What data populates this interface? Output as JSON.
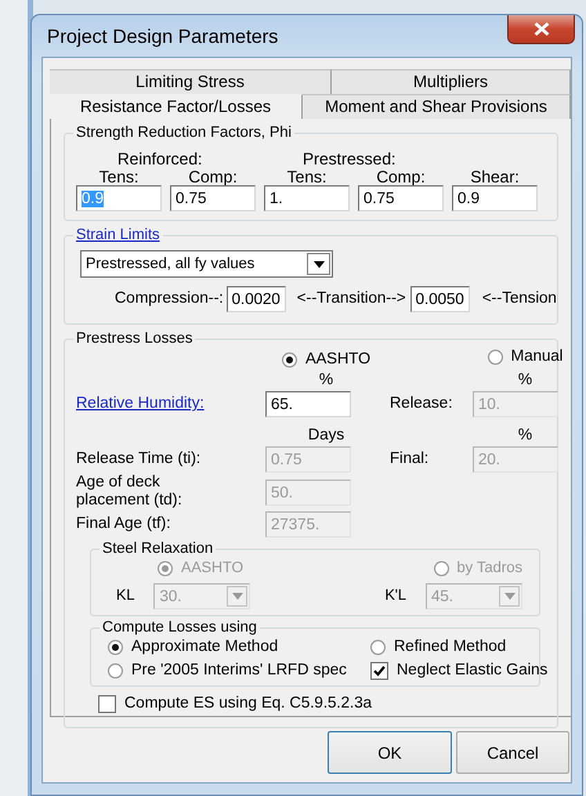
{
  "window": {
    "title": "Project Design Parameters"
  },
  "tab_rows": [
    [
      {
        "label": "Limiting Stress",
        "selected": false
      },
      {
        "label": "Multipliers",
        "selected": false
      }
    ],
    [
      {
        "label": "Resistance Factor/Losses",
        "selected": true
      },
      {
        "label": "Moment and Shear Provisions",
        "selected": false
      }
    ]
  ],
  "strength_reduction": {
    "title": "Strength Reduction Factors, Phi",
    "group_labels": [
      "Reinforced:",
      "Prestressed:"
    ],
    "fields": [
      {
        "label": "Tens:",
        "value": "0.9",
        "selected": true
      },
      {
        "label": "Comp:",
        "value": "0.75",
        "selected": false
      },
      {
        "label": "Tens:",
        "value": "1.",
        "selected": false
      },
      {
        "label": "Comp:",
        "value": "0.75",
        "selected": false
      },
      {
        "label": "Shear:",
        "value": "0.9",
        "selected": false
      }
    ]
  },
  "strain_limits": {
    "title": "Strain Limits",
    "dropdown": "Prestressed, all fy values",
    "compression_label": "Compression--:",
    "compression": "0.0020",
    "transition_label": "<--Transition-->",
    "tension": "0.0050",
    "tension_label": "<--Tension"
  },
  "prestress_losses": {
    "title": "Prestress Losses",
    "methods": [
      {
        "label": "AASHTO",
        "unit": "%",
        "selected": true
      },
      {
        "label": "Manual",
        "unit": "%",
        "selected": false
      }
    ],
    "humidity": {
      "label": "Relative Humidity:",
      "value": "65.",
      "disabled": false
    },
    "release": {
      "label": "Release:",
      "value": "10.",
      "disabled": true
    },
    "days_header": "Days",
    "percent_header": "%",
    "release_time": {
      "label": "Release Time (ti):",
      "value": "0.75",
      "disabled": true
    },
    "final": {
      "label": "Final:",
      "value": "20.",
      "disabled": true
    },
    "deck_age": {
      "label": "Age of deck placement (td):",
      "value": "50.",
      "disabled": true
    },
    "final_age": {
      "label": "Final Age (tf):",
      "value": "27375.",
      "disabled": true
    },
    "steel_relaxation": {
      "title": "Steel Relaxation",
      "disabled": true,
      "options": [
        {
          "label": "AASHTO",
          "selected": true
        },
        {
          "label": "by Tadros",
          "selected": false
        }
      ],
      "dropdowns": [
        {
          "label": "KL",
          "value": "30."
        },
        {
          "label": "K'L",
          "value": "45."
        }
      ]
    },
    "compute_losses": {
      "title": "Compute Losses using",
      "options": [
        {
          "kind": "radio",
          "label": "Approximate Method",
          "selected": true
        },
        {
          "kind": "radio",
          "label": "Refined Method",
          "selected": false
        },
        {
          "kind": "radio",
          "label": "Pre '2005 Interims' LRFD spec",
          "selected": false
        },
        {
          "kind": "checkbox",
          "label": "Neglect Elastic Gains",
          "checked": true
        }
      ]
    },
    "compute_es": {
      "label": "Compute ES using Eq. C5.9.5.2.3a",
      "checked": false
    }
  },
  "buttons": [
    "OK",
    "Cancel"
  ]
}
